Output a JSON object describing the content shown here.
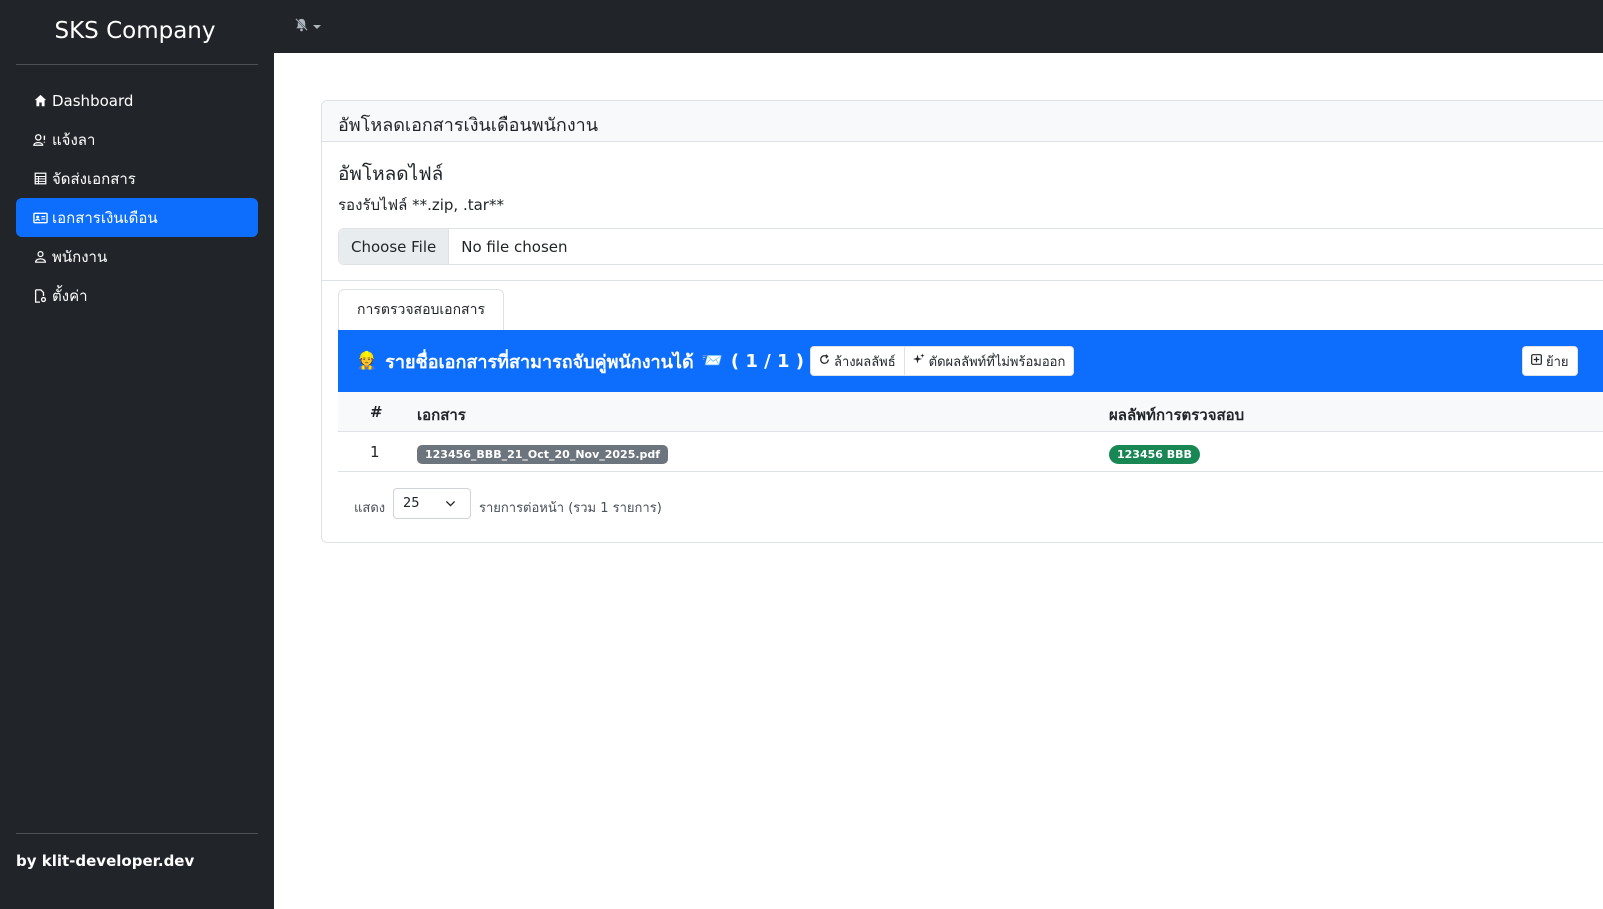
{
  "sidebar": {
    "brand": "SKS Company",
    "items": [
      {
        "label": "Dashboard",
        "icon": "home-icon",
        "active": false
      },
      {
        "label": "แจ้งลา",
        "icon": "user-leave-icon",
        "active": false
      },
      {
        "label": "จัดส่งเอกสาร",
        "icon": "table-icon",
        "active": false
      },
      {
        "label": "เอกสารเงินเดือน",
        "icon": "id-card-icon",
        "active": true
      },
      {
        "label": "พนักงาน",
        "icon": "person-icon",
        "active": false
      },
      {
        "label": "ตั้งค่า",
        "icon": "file-gear-icon",
        "active": false
      }
    ],
    "footer": "by klit-developer.dev"
  },
  "topbar": {
    "notification_icon": "bell-slash-icon"
  },
  "card": {
    "header": "อัพโหลดเอกสารเงินเดือนพนักงาน",
    "upload_title": "อัพโหลดไฟล์",
    "upload_sub": "รองรับไฟล์ **.zip, .tar**",
    "file_button": "Choose File",
    "file_status": "No file chosen"
  },
  "tab": {
    "label": "การตรวจสอบเอกสาร"
  },
  "bar": {
    "emoji": "👷",
    "title": "รายชื่อเอกสารที่สามารถจับคู่พนักงานได้",
    "emoji2": "📨",
    "count": "( 1 / 1 )",
    "clear_btn": "ล้างผลลัพธ์",
    "cut_btn": "ตัดผลลัพท์ที่ไม่พร้อมออก",
    "move_btn": "ย้าย"
  },
  "table": {
    "headers": [
      "#",
      "เอกสาร",
      "ผลลัพท์การตรวจสอบ"
    ],
    "rows": [
      {
        "num": "1",
        "file": "123456_BBB_21_Oct_20_Nov_2025.pdf",
        "result": "123456 BBB"
      }
    ]
  },
  "pager": {
    "show_label": "แสดง",
    "per_page": "25",
    "per_page_label": "รายการต่อหน้า (รวม 1 รายการ)"
  },
  "colors": {
    "sidebar_bg": "#212529",
    "accent": "#0d6efd",
    "success": "#198754",
    "secondary": "#6c757d"
  }
}
